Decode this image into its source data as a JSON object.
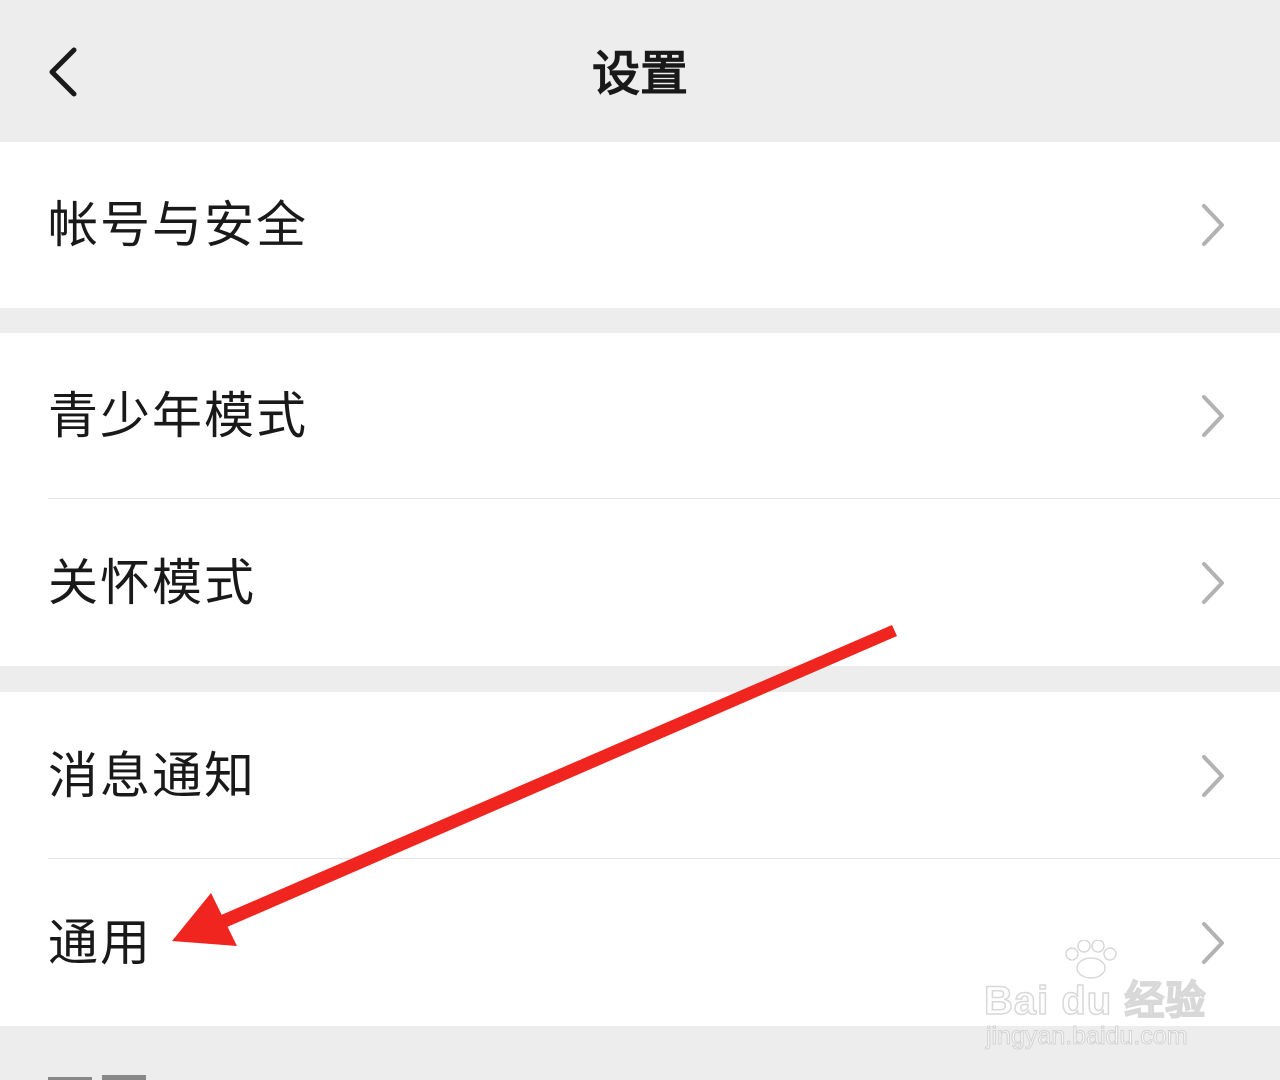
{
  "header": {
    "title": "设置",
    "back_icon": "chevron-left-icon"
  },
  "groups": [
    {
      "items": [
        {
          "label": "帐号与安全",
          "icon": "chevron-right-icon"
        }
      ]
    },
    {
      "items": [
        {
          "label": "青少年模式",
          "icon": "chevron-right-icon"
        },
        {
          "label": "关怀模式",
          "icon": "chevron-right-icon"
        }
      ]
    },
    {
      "items": [
        {
          "label": "消息通知",
          "icon": "chevron-right-icon"
        },
        {
          "label": "通用",
          "icon": "chevron-right-icon"
        }
      ]
    }
  ],
  "annotation": {
    "arrow_color": "#f0251f",
    "points_to": "通用"
  },
  "watermark": {
    "brand": "Bai du 经验",
    "url": "jingyan.baidu.com"
  },
  "colors": {
    "background": "#ededed",
    "row": "#ffffff",
    "text": "#191919",
    "chevron": "#b2b2b2",
    "divider": "#e5e5e5"
  }
}
